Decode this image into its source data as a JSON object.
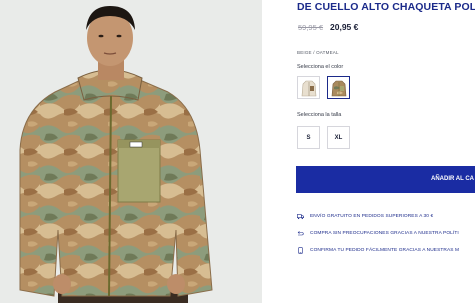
{
  "product": {
    "title": "DE CUELLO ALTO CHAQUETA POLAR",
    "old_price": "59,95 €",
    "new_price": "20,95 €",
    "color_code": "BEIGE / OATMEAL",
    "color_label": "Selecciona el color",
    "size_label": "Selecciona la talla",
    "sizes": [
      "S",
      "XL"
    ],
    "add_button": "AÑADIR AL CA"
  },
  "features": [
    {
      "icon": "truck-icon",
      "text": "ENVÍO GRATUITO EN PEDIDOS SUPERIORES A 30 €"
    },
    {
      "icon": "return-icon",
      "text": "COMPRA SIN PREOCUPACIONES GRACIAS A NUESTRA POLÍTI"
    },
    {
      "icon": "phone-icon",
      "text": "CONFIRMA TU PEDIDO FÁCILMENTE GRACIAS A NUESTRAS M"
    }
  ],
  "colors": {
    "brand_blue": "#1b2a8a",
    "button_blue": "#1a2ca3",
    "swatch_selected_border": "#1b2a8a"
  }
}
